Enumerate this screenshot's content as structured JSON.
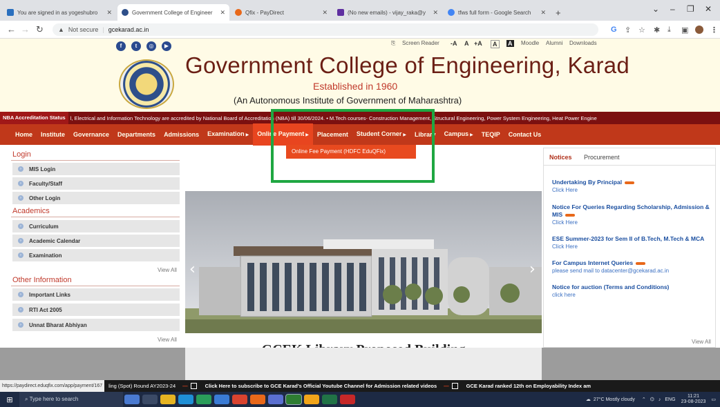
{
  "browser": {
    "tabs": [
      {
        "label": "You are signed in as yogeshubro",
        "color": "#2a6fbe"
      },
      {
        "label": "Government College of Engineer",
        "color": "#2e4f8a",
        "active": true
      },
      {
        "label": "Qfix - PayDirect",
        "color": "#e8681a"
      },
      {
        "label": "(No new emails) - vijay_raka@y",
        "color": "#5f2fa0"
      },
      {
        "label": "tfws full form - Google Search",
        "color": "#4285f4"
      }
    ],
    "new_tab": "+",
    "security": "Not secure",
    "url": "gcekarad.ac.in"
  },
  "header": {
    "utility": {
      "screen_reader": "Screen Reader",
      "font_small": "-A",
      "font_normal": "A",
      "font_large": "+A",
      "contrast_light": "A",
      "contrast_dark": "A",
      "moodle": "Moodle",
      "alumni": "Alumni",
      "downloads": "Downloads"
    },
    "college_name": "Government College of Engineering, Karad",
    "established": "Established in 1960",
    "autonomous": "(An Autonomous Institute of Government of Maharashtra)"
  },
  "ticker": {
    "badge": "NBA Accreditation Status",
    "text": "l, Electrical and Information Technology are accredited by National Board of Accreditation (NBA) till 30/06/2024.   • M.Tech courses- Construction Management, Structural Engineering, Power System Engineering, Heat Power Engine"
  },
  "nav": {
    "items": [
      "Home",
      "Institute",
      "Governance",
      "Departments",
      "Admissions",
      "Examination",
      "Online Payment",
      "Placement",
      "Student Corner",
      "Library",
      "Campus",
      "TEQIP",
      "Contact Us"
    ],
    "dropdown_item": "Online Fee Payment (HDFC EduQFix)"
  },
  "sidebar": {
    "login_title": "Login",
    "login_items": [
      "MIS Login",
      "Faculty/Staff",
      "Other Login"
    ],
    "academics_title": "Academics",
    "academics_items": [
      "Curriculum",
      "Academic Calendar",
      "Examination"
    ],
    "view_all_1": "View All",
    "other_title": "Other Information",
    "other_items": [
      "Important Links",
      "RTI Act 2005",
      "Unnat Bharat Abhiyan"
    ],
    "view_all_2": "View All"
  },
  "slider": {
    "caption": "GCEK Library Proposed Building"
  },
  "notices": {
    "tab_notices": "Notices",
    "tab_procurement": "Procurement",
    "items": [
      {
        "title": "Undertaking By Principal",
        "sub": "Click Here"
      },
      {
        "title": "Notice For Queries Regarding Scholarship, Admission & MIS",
        "sub": "Click Here"
      },
      {
        "title": "ESE Summer-2023 for Sem II of B.Tech, M.Tech & MCA",
        "sub": "Click Here"
      },
      {
        "title": "For Campus Internet Queries",
        "sub": "please send mail to datacenter@gcekarad.ac.in"
      },
      {
        "title": "Notice for auction (Terms and Conditions)",
        "sub": "click here"
      }
    ],
    "view_all": "View All"
  },
  "footer_ticker": {
    "status_url": "https://paydirect.eduqfix.com/app/payment/167",
    "seg1": "ling (Spot) Round AY2023-24",
    "seg2": "Click Here to subscribe to GCE Karad's Official Youtube Channel for Admission related videos",
    "seg3": "GCE Karad ranked 12th on Employability Index am"
  },
  "taskbar": {
    "search": "Type here to search",
    "weather": "27°C  Mostly cloudy",
    "lang": "ENG",
    "time": "11:21",
    "date": "23-08-2023"
  },
  "colors": {
    "nav_bg": "#c0381a",
    "dropdown_bg": "#e84a1f",
    "highlight_border": "#1fa742",
    "title_color": "#6b1f15"
  }
}
